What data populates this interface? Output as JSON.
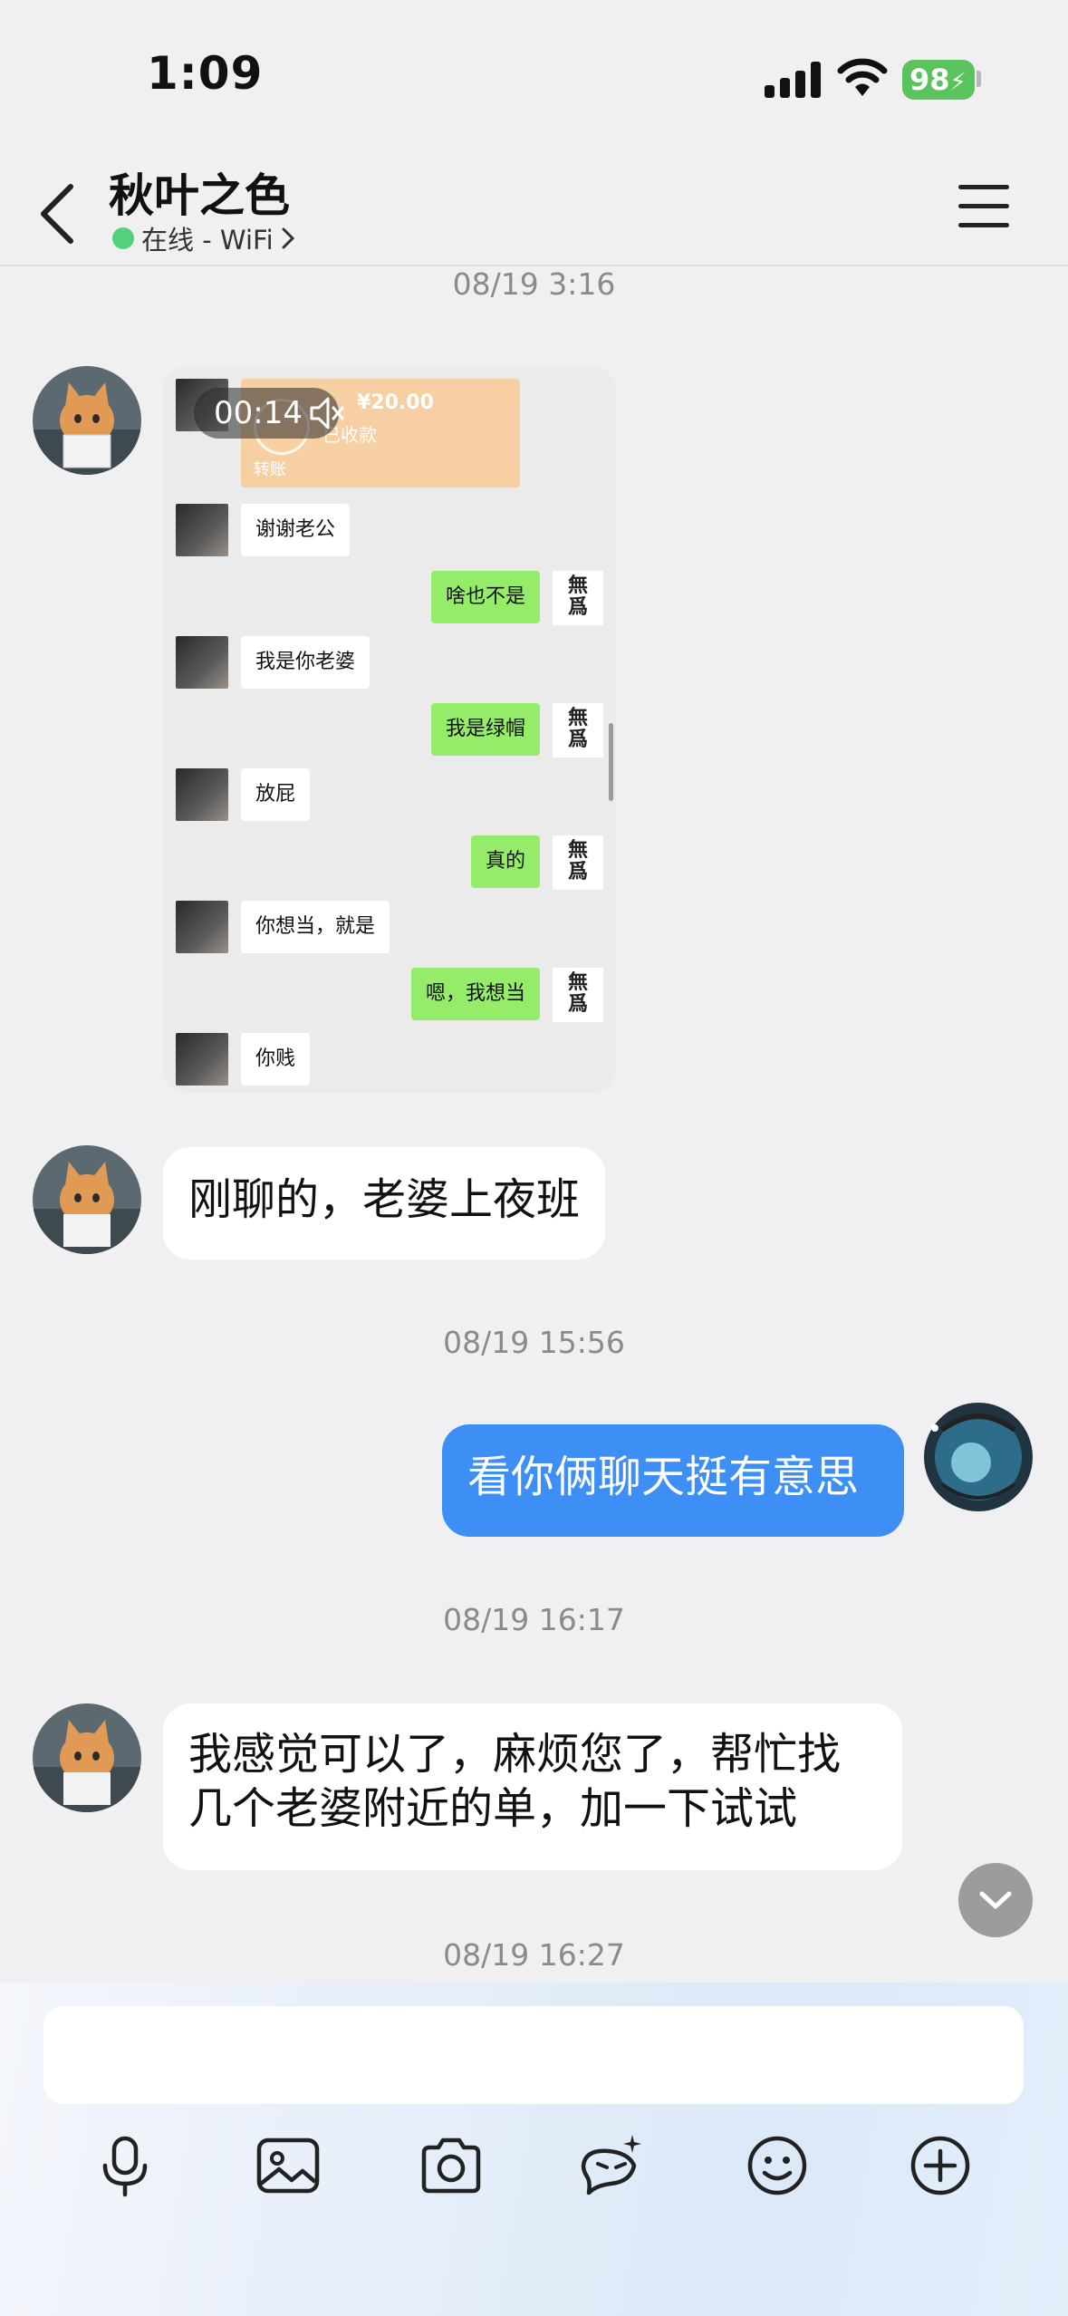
{
  "status_bar": {
    "time": "1:09",
    "battery": "98"
  },
  "header": {
    "name": "秋叶之色",
    "status": "在线 - WiFi"
  },
  "timestamps": [
    "08/19 3:16",
    "08/19 15:56",
    "08/19 16:17",
    "08/19 16:27"
  ],
  "screenshot": {
    "video_time": "00:14",
    "transfer_amount": "¥20.00",
    "transfer_status": "已收款",
    "transfer_label": "转账",
    "messages": [
      {
        "side": "left",
        "text": "谢谢老公"
      },
      {
        "side": "right",
        "text": "啥也不是"
      },
      {
        "side": "left",
        "text": "我是你老婆"
      },
      {
        "side": "right",
        "text": "我是绿帽"
      },
      {
        "side": "left",
        "text": "放屁"
      },
      {
        "side": "right",
        "text": "真的"
      },
      {
        "side": "left",
        "text": "你想当，就是"
      },
      {
        "side": "right",
        "text": "嗯，我想当"
      },
      {
        "side": "left",
        "text": "你贱"
      }
    ],
    "stamp_text": "無爲"
  },
  "messages": {
    "m1": "刚聊的，老婆上夜班",
    "m2": "看你俩聊天挺有意思",
    "m3_line1": "我感觉可以了，麻烦您了，帮忙找",
    "m3_line2": "几个老婆附近的单，加一下试试"
  },
  "input": {
    "placeholder": ""
  },
  "toolbar": {
    "icons": [
      "microphone-icon",
      "image-icon",
      "camera-icon",
      "magic-wand-icon",
      "emoji-icon",
      "plus-icon"
    ]
  },
  "colors": {
    "accent": "#3d8ff5",
    "online": "#56d07a",
    "battery": "#5ac35d",
    "sent_green": "#95ec69"
  }
}
